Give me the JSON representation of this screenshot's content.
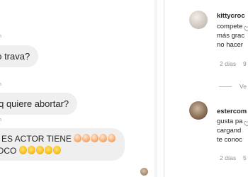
{
  "chat": {
    "messages": [
      {
        "meta": "n",
        "text": "no trava?"
      },
      {
        "meta": "n",
        "text": "s q quiere abortar?"
      },
      {
        "meta": "n",
        "line1": "IZ ES ACTOR TIENE",
        "line2": "POCO"
      }
    ],
    "emoji": {
      "egg_count": 5,
      "laugh_count": 5
    }
  },
  "comments": [
    {
      "username": "kittycroc",
      "lines": [
        "compete",
        "más grac",
        "no hacer"
      ],
      "time": "2 días",
      "likes": "9",
      "view_replies": "Ve"
    },
    {
      "username": "estercom",
      "lines": [
        "gusta pa",
        "cargand",
        "te conoc"
      ],
      "time": "2 días",
      "likes": "5"
    }
  ],
  "icons": [
    "heart-icon",
    "heart-icon"
  ]
}
